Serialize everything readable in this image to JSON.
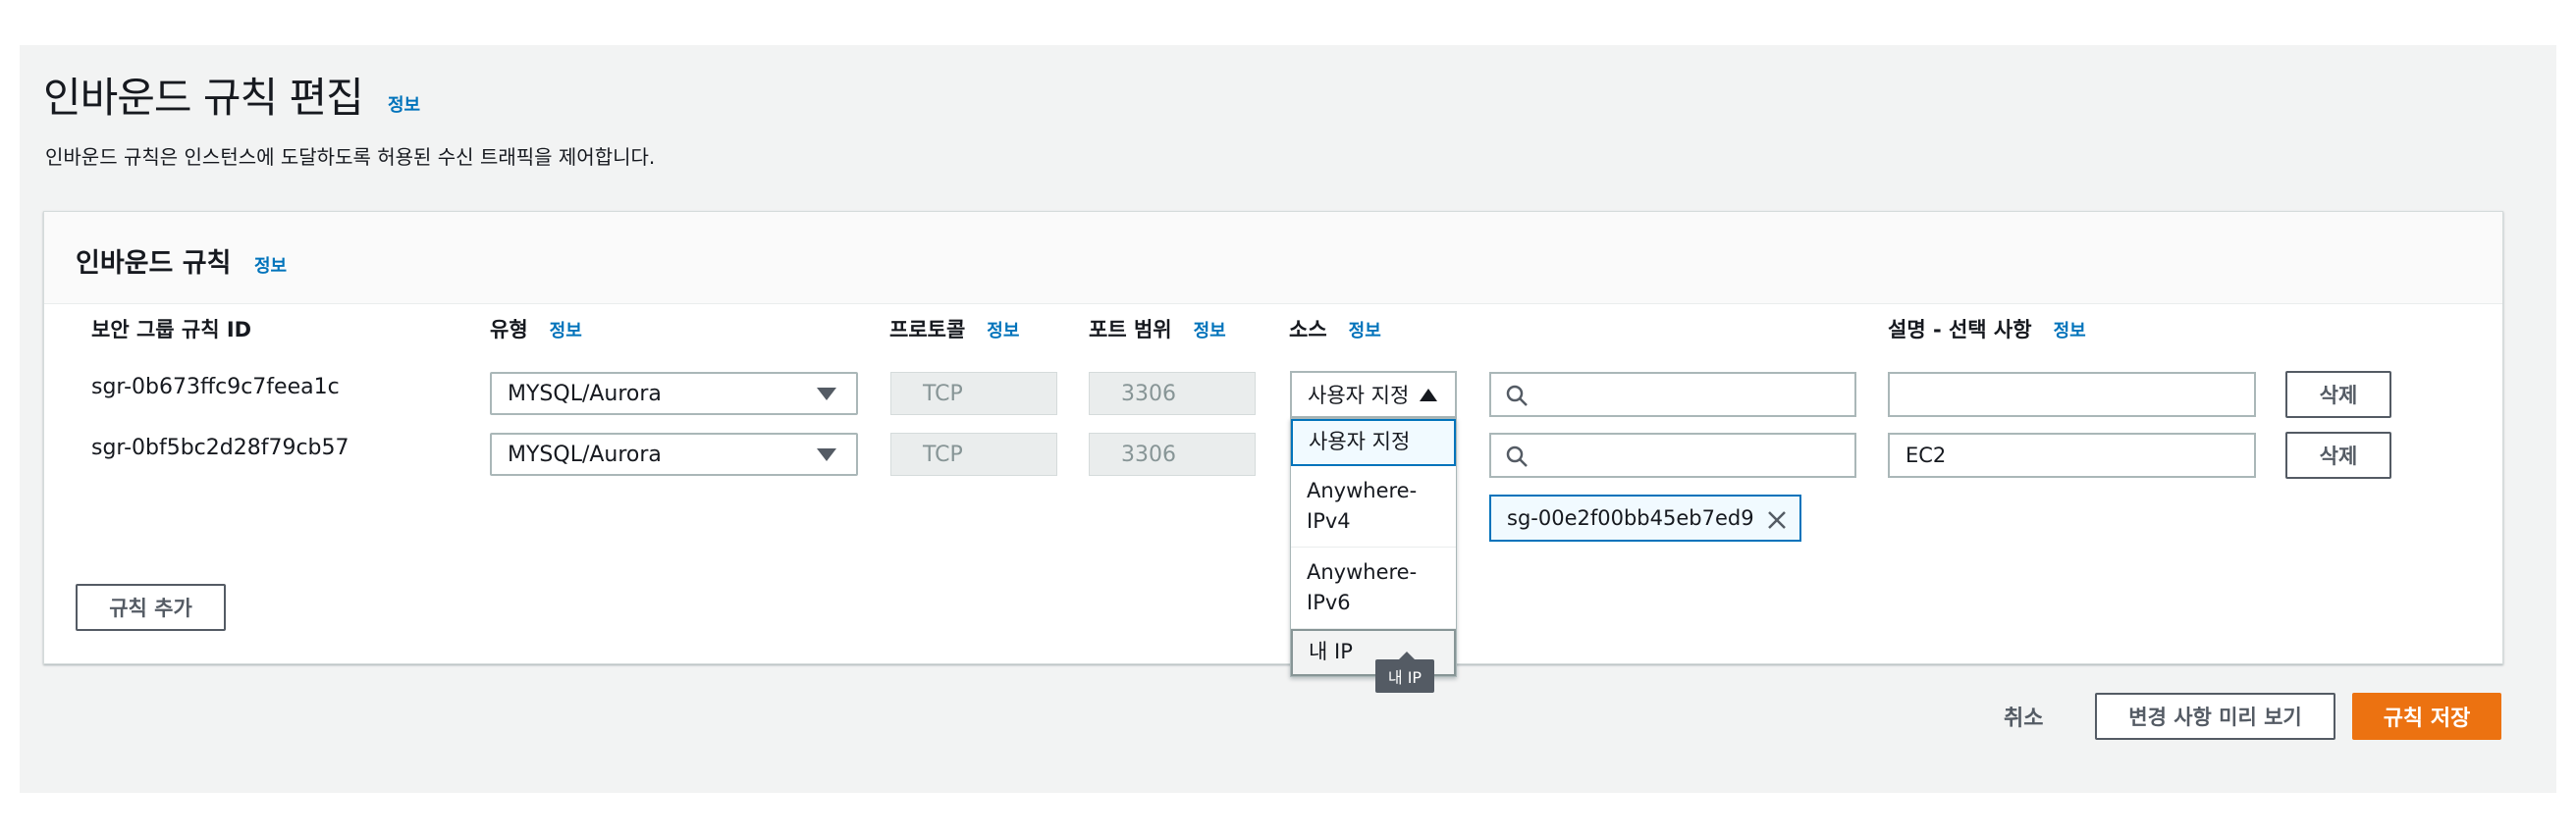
{
  "page": {
    "title": "인바운드 규칙 편집",
    "title_info": "정보",
    "description": "인바운드 규칙은 인스턴스에 도달하도록 허용된 수신 트래픽을 제어합니다."
  },
  "panel": {
    "title": "인바운드 규칙",
    "info": "정보",
    "columns": {
      "rule_id": "보안 그룹 규칙 ID",
      "type": "유형",
      "protocol": "프로토콜",
      "port": "포트 범위",
      "source": "소스",
      "description": "설명 - 선택 사항",
      "info": "정보"
    },
    "rows": [
      {
        "rule_id": "sgr-0b673ffc9c7feea1c",
        "type": "MYSQL/Aurora",
        "protocol": "TCP",
        "port": "3306",
        "source": "사용자 지정",
        "description": "",
        "delete_label": "삭제"
      },
      {
        "rule_id": "sgr-0bf5bc2d28f79cb57",
        "type": "MYSQL/Aurora",
        "protocol": "TCP",
        "port": "3306",
        "description": "EC2",
        "delete_label": "삭제",
        "token": "sg-00e2f00bb45eb7ed9"
      }
    ],
    "source_options": [
      "사용자 지정",
      "Anywhere-IPv4",
      "Anywhere-IPv6",
      "내 IP"
    ],
    "source_options_display": [
      "사용자 지정",
      "Anywhere-\nIPv4",
      "Anywhere-\nIPv6",
      "내 IP"
    ],
    "tooltip": "내 IP",
    "add_rule_label": "규칙 추가"
  },
  "footer": {
    "cancel_label": "취소",
    "preview_label": "변경 사항 미리 보기",
    "save_label": "규칙 저장"
  },
  "colors": {
    "accent": "#0073bb",
    "primary": "#ec7211",
    "background": "#f2f3f3"
  },
  "icons": [
    "search-icon",
    "close-icon",
    "caret-down-icon",
    "caret-up-icon"
  ]
}
